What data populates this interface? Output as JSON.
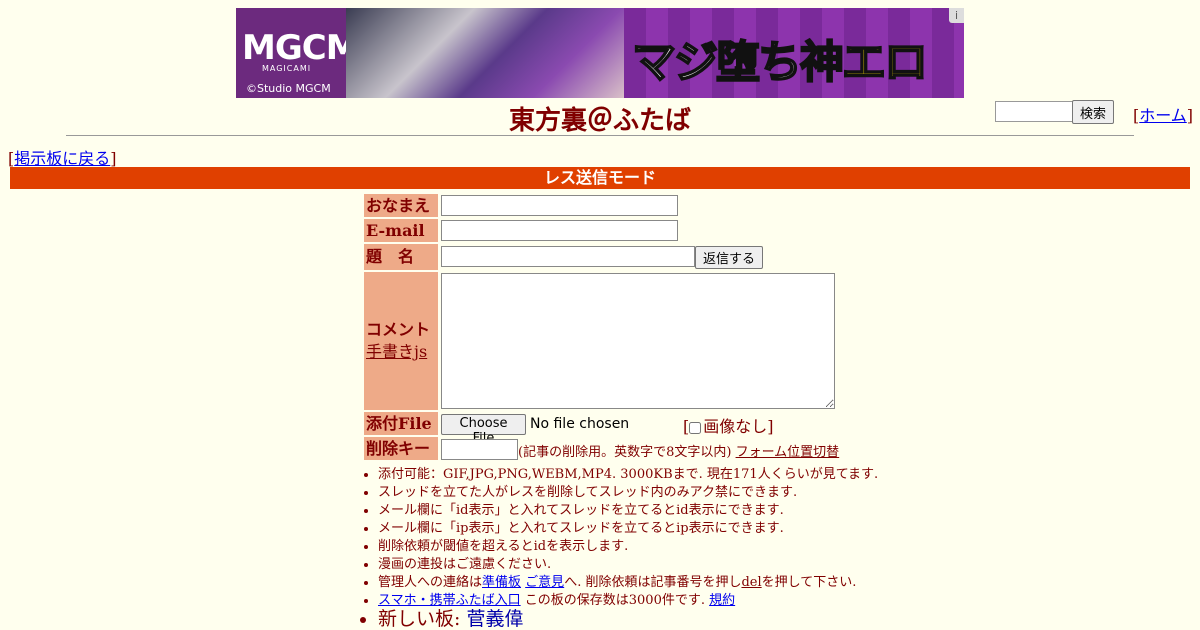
{
  "banner": {
    "logo": "MGCM",
    "sub": "MAGICAMI",
    "copyright": "©Studio MGCM",
    "catch_a": "マジ",
    "catch_b": "堕",
    "catch_c": "ち",
    "catch_d": "神",
    "catch_e": "エロゲ",
    "info_icon": "i"
  },
  "header": {
    "title": "東方裏＠ふたば",
    "search_button": "検索",
    "home_open": "[",
    "home_link": "ホーム",
    "home_close": "]",
    "back_open": "[",
    "back_link": "掲示板に戻る",
    "back_close": "]"
  },
  "mode_bar": "レス送信モード",
  "form": {
    "name_label": "おなまえ",
    "email_label": "E-mail",
    "subject_label": "題　名",
    "submit_button": "返信する",
    "comment_label": "コメント",
    "handwriting_link": "手書きjs",
    "file_label": "添付File",
    "choose_file": "Choose File",
    "no_file": "No file chosen",
    "no_image_open": "[",
    "no_image": "画像なし",
    "no_image_close": "]",
    "delkey_label": "削除キー",
    "delkey_note": "(記事の削除用。英数字で8文字以内)",
    "form_toggle": "フォーム位置切替"
  },
  "notes": {
    "n1": "添付可能：GIF,JPG,PNG,WEBM,MP4. 3000KBまで. 現在171人くらいが見てます.",
    "n2": "スレッドを立てた人がレスを削除してスレッド内のみアク禁にできます.",
    "n3": "メール欄に「id表示」と入れてスレッドを立てるとid表示にできます.",
    "n4": "メール欄に「ip表示」と入れてスレッドを立てるとip表示にできます.",
    "n5": "削除依頼が閾値を超えるとidを表示します.",
    "n6": "漫画の連投はご遠慮ください.",
    "n7_a": "管理人への連絡は",
    "n7_link1": "準備板",
    "n7_link2": "ご意見",
    "n7_b": "へ. 削除依頼は記事番号を押し",
    "n7_del": "del",
    "n7_c": "を押して下さい.",
    "n8_link": "スマホ・携帯ふたば入口",
    "n8_text": " この板の保存数は3000件です.",
    "n8_rules": "規約",
    "n9_text": "新しい板: ",
    "n9_link": "菅義偉"
  },
  "colors": {
    "background": "#ffffee",
    "text": "#800000",
    "mode_bar": "#e04000",
    "label_bg": "#eeaa88",
    "link": "#0000ee"
  }
}
